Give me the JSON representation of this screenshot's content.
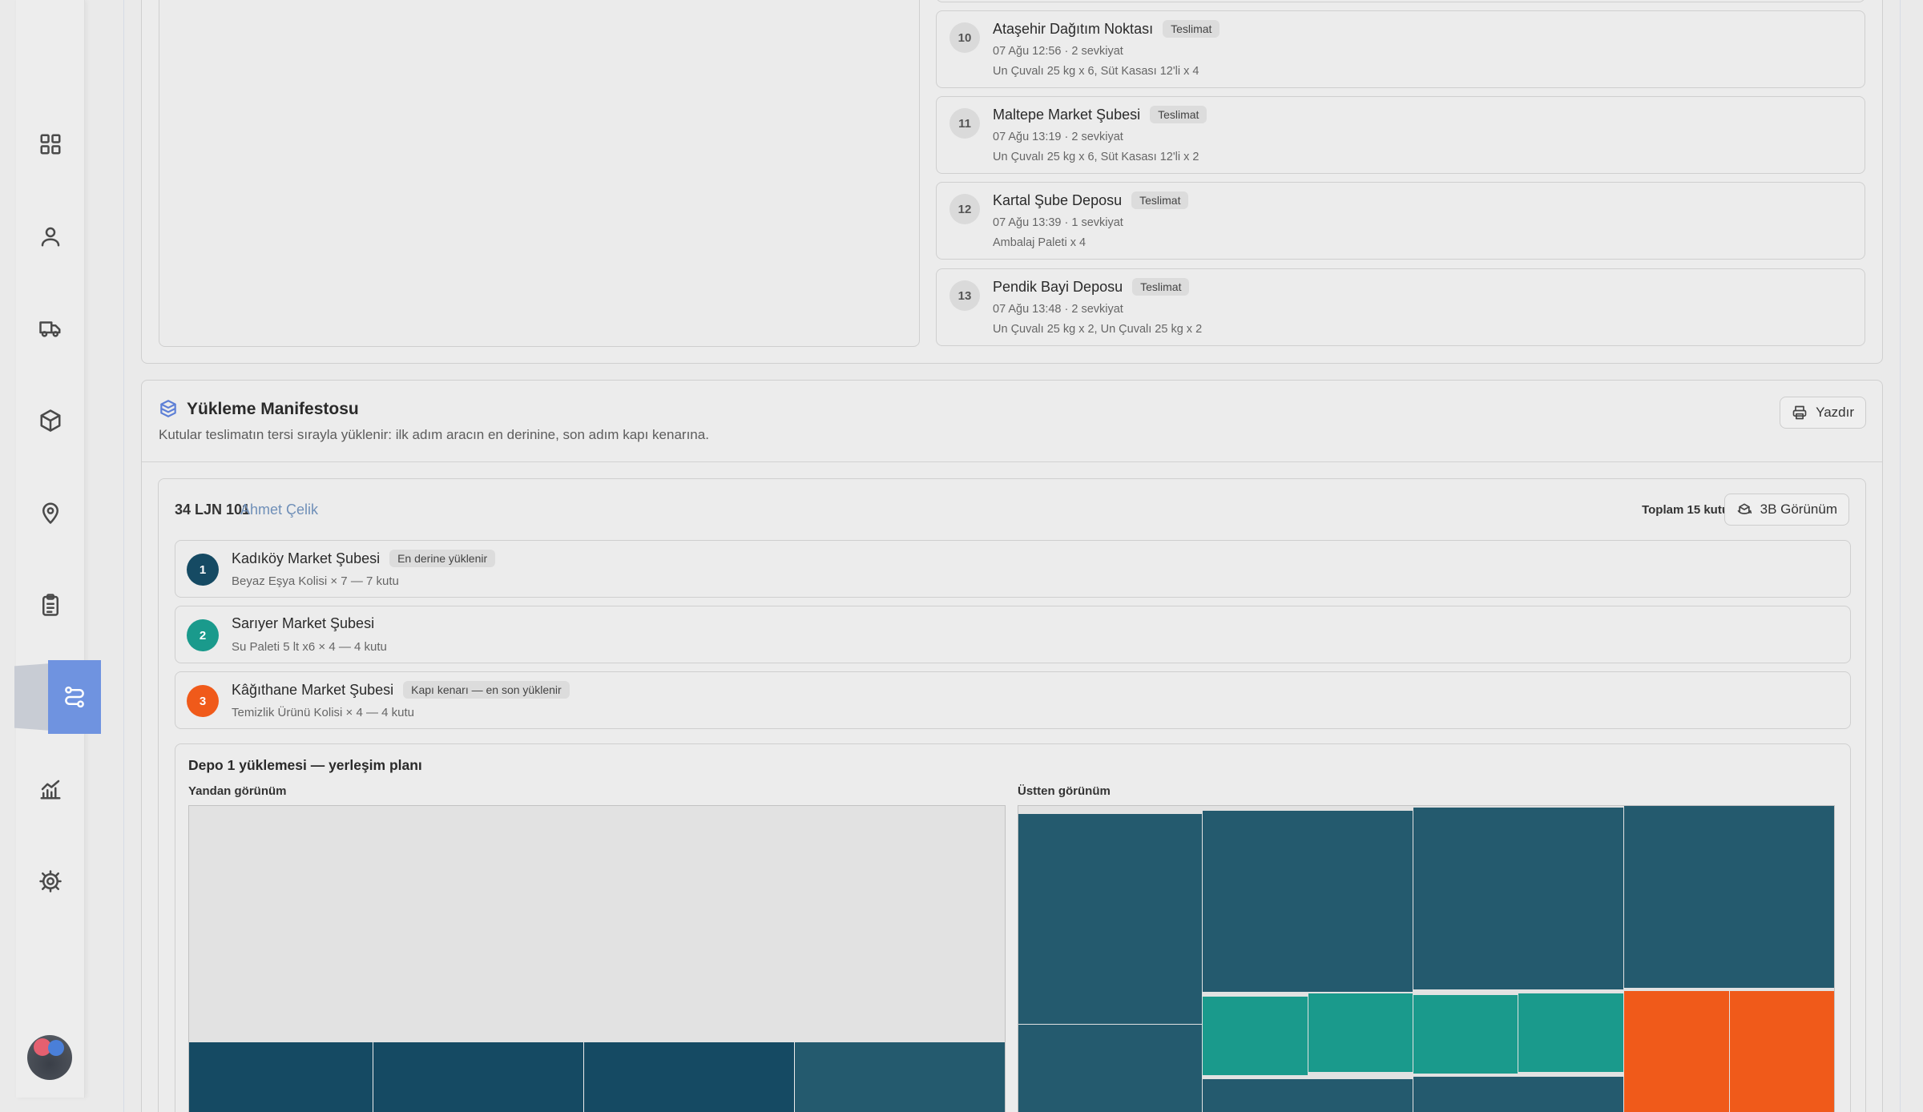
{
  "sidebar": {
    "items": [
      {
        "name": "dashboard",
        "icon": "grid-icon"
      },
      {
        "name": "users",
        "icon": "user-icon"
      },
      {
        "name": "vehicles",
        "icon": "truck-icon"
      },
      {
        "name": "packages",
        "icon": "box-icon"
      },
      {
        "name": "locations",
        "icon": "pin-icon"
      },
      {
        "name": "orders",
        "icon": "clipboard-icon"
      },
      {
        "name": "routes",
        "icon": "route-icon",
        "active": true
      },
      {
        "name": "reports",
        "icon": "chart-icon"
      },
      {
        "name": "settings",
        "icon": "gear-icon"
      }
    ],
    "accent": "#6f93e0"
  },
  "stops": [
    {
      "num": "10",
      "name": "Ataşehir Dağıtım Noktası",
      "badge": "Teslimat",
      "meta": "07 Ağu 12:56 · 2 sevkiyat",
      "items": "Un Çuvalı 25 kg x 6, Süt Kasası 12'li x 4"
    },
    {
      "num": "11",
      "name": "Maltepe Market Şubesi",
      "badge": "Teslimat",
      "meta": "07 Ağu 13:19 · 2 sevkiyat",
      "items": "Un Çuvalı 25 kg x 6, Süt Kasası 12'li x 2"
    },
    {
      "num": "12",
      "name": "Kartal Şube Deposu",
      "badge": "Teslimat",
      "meta": "07 Ağu 13:39 · 1 sevkiyat",
      "items": "Ambalaj Paleti x 4"
    },
    {
      "num": "13",
      "name": "Pendik Bayi Deposu",
      "badge": "Teslimat",
      "meta": "07 Ağu 13:48 · 2 sevkiyat",
      "items": "Un Çuvalı 25 kg x 2, Un Çuvalı 25 kg x 2"
    }
  ],
  "manifest": {
    "title": "Yükleme Manifestosu",
    "subtitle": "Kutular teslimatın tersi sırayla yüklenir: ilk adım aracın en derinine, son adım kapı kenarına.",
    "print_label": "Yazdır",
    "vehicle": {
      "plate": "34 LJN 101",
      "driver": "Ahmet Çelik",
      "total": "Toplam 15 kutu",
      "view_label": "3B Görünüm"
    },
    "loads": [
      {
        "step": "1",
        "name": "Kadıköy Market Şubesi",
        "badge": "En derine yüklenir",
        "detail": "Beyaz Eşya Kolisi × 7 — 7 kutu",
        "color": "#154a63"
      },
      {
        "step": "2",
        "name": "Sarıyer Market Şubesi",
        "badge": "",
        "detail": "Su Paleti 5 lt x6 × 4 — 4 kutu",
        "color": "#1a9a8c"
      },
      {
        "step": "3",
        "name": "Kâğıthane Market Şubesi",
        "badge": "Kapı kenarı — en son yüklenir",
        "detail": "Temizlik Ürünü Kolisi × 4 — 4 kutu",
        "color": "#f05a1a"
      }
    ],
    "plan": {
      "title": "Depo 1 yüklemesi — yerleşim planı",
      "side_label": "Yandan görünüm",
      "top_label": "Üstten görünüm",
      "colors": {
        "deep": "#154a63",
        "deep_alt": "#245a6e",
        "mid": "#1a9a8c",
        "door": "#f05a1a",
        "empty": "#e2e2e2"
      }
    }
  }
}
